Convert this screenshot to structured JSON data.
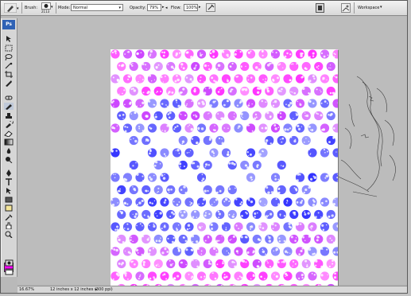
{
  "options_bar": {
    "brush_label": "Brush:",
    "brush_size": "2113",
    "mode_label": "Mode:",
    "mode_value": "Normal",
    "opacity_label": "Opacity:",
    "opacity_value": "79%",
    "flow_label": "Flow:",
    "flow_value": "100%",
    "workspace_label": "Workspace"
  },
  "toolbox": {
    "logo": "Ps",
    "foreground_color": "#ff00ff",
    "background_color": "#ffffff"
  },
  "status_bar": {
    "zoom": "16.67%",
    "doc_info": "12 inches x 12 inches (300 ppi)"
  },
  "document": {
    "dot_colors": [
      "#ff33ff",
      "#cc44ff",
      "#5555ff",
      "#3333ff"
    ]
  }
}
